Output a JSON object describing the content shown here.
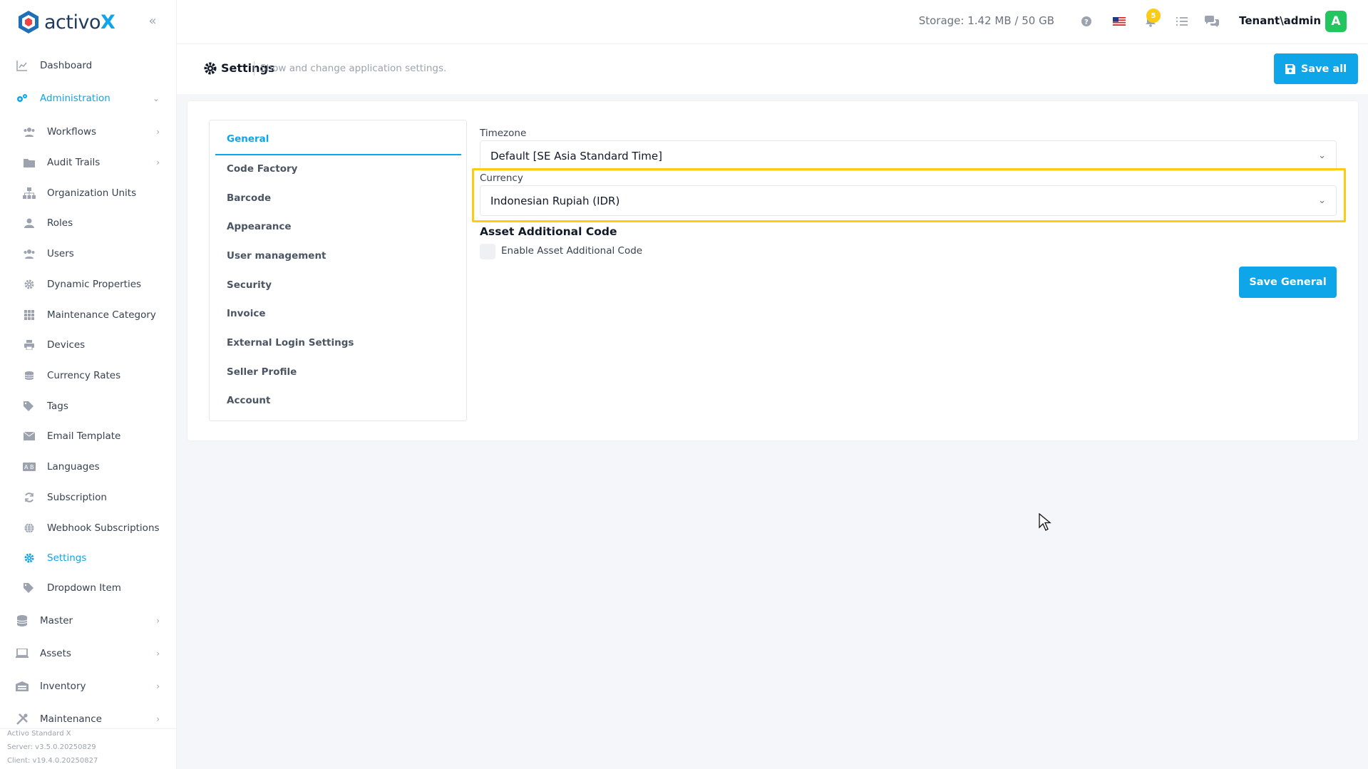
{
  "brand": {
    "name": "activo",
    "accent": "X"
  },
  "sidebar": {
    "items": [
      {
        "label": "Dashboard",
        "icon": "chart-line-icon"
      },
      {
        "label": "Administration",
        "icon": "cogs-icon"
      },
      {
        "label": "Workflows",
        "icon": "users-icon"
      },
      {
        "label": "Audit Trails",
        "icon": "folder-icon"
      },
      {
        "label": "Organization Units",
        "icon": "sitemap-icon"
      },
      {
        "label": "Roles",
        "icon": "user-icon"
      },
      {
        "label": "Users",
        "icon": "users-icon"
      },
      {
        "label": "Dynamic Properties",
        "icon": "gear-icon"
      },
      {
        "label": "Maintenance Category",
        "icon": "grid-icon"
      },
      {
        "label": "Devices",
        "icon": "printer-icon"
      },
      {
        "label": "Currency Rates",
        "icon": "coins-icon"
      },
      {
        "label": "Tags",
        "icon": "tags-icon"
      },
      {
        "label": "Email Template",
        "icon": "envelope-icon"
      },
      {
        "label": "Languages",
        "icon": "language-icon"
      },
      {
        "label": "Subscription",
        "icon": "refresh-icon"
      },
      {
        "label": "Webhook Subscriptions",
        "icon": "globe-icon"
      },
      {
        "label": "Settings",
        "icon": "gear-icon"
      },
      {
        "label": "Dropdown Item",
        "icon": "tags-icon"
      },
      {
        "label": "Master",
        "icon": "database-icon"
      },
      {
        "label": "Assets",
        "icon": "laptop-icon"
      },
      {
        "label": "Inventory",
        "icon": "warehouse-icon"
      },
      {
        "label": "Maintenance",
        "icon": "tools-icon"
      }
    ],
    "version": {
      "product": "Activo Standard X",
      "server": "Server: v3.5.0.20250829",
      "client": "Client: v19.4.0.20250827"
    }
  },
  "topbar": {
    "storage": "Storage: 1.42 MB / 50 GB",
    "notification_count": "5",
    "user": "Tenant\\admin",
    "avatar_initial": "A"
  },
  "page": {
    "title": "Settings",
    "description": "Show and change application settings.",
    "save_all_label": "Save all"
  },
  "tabs": [
    "General",
    "Code Factory",
    "Barcode",
    "Appearance",
    "User management",
    "Security",
    "Invoice",
    "External Login Settings",
    "Seller Profile",
    "Account"
  ],
  "general": {
    "timezone_label": "Timezone",
    "timezone_value": "Default [SE Asia Standard Time]",
    "currency_label": "Currency",
    "currency_value": "Indonesian Rupiah (IDR)",
    "asset_code_title": "Asset Additional Code",
    "asset_code_checkbox_label": "Enable Asset Additional Code",
    "save_label": "Save General"
  },
  "colors": {
    "accent": "#0ea5e9",
    "highlight": "#facc15",
    "avatar": "#22c55e"
  }
}
